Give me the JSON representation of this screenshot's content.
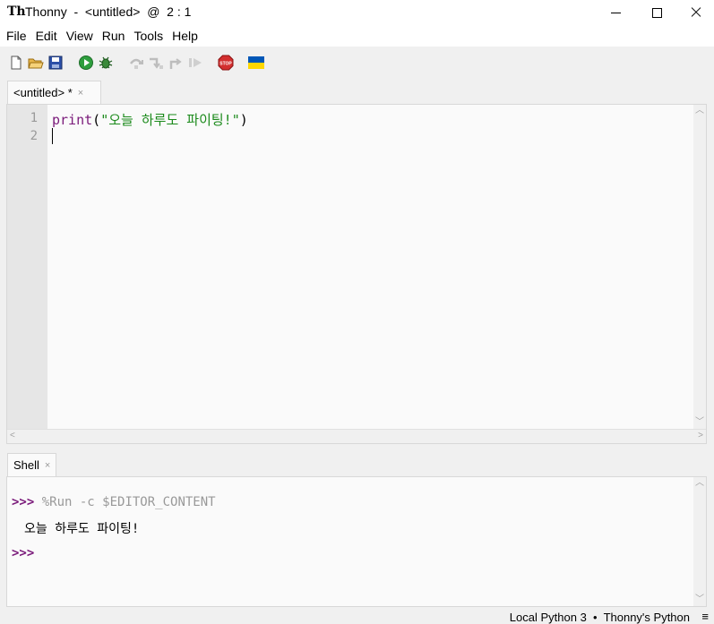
{
  "window": {
    "logo": "Th",
    "title": "Thonny  -  <untitled>  @  2 : 1",
    "controls": {
      "minimize_icon": "minimize-icon",
      "maximize_icon": "maximize-icon",
      "close_icon": "close-icon"
    }
  },
  "menu": [
    "File",
    "Edit",
    "View",
    "Run",
    "Tools",
    "Help"
  ],
  "toolbar": {
    "buttons": [
      {
        "name": "new-file",
        "icon": "new-file-icon"
      },
      {
        "name": "open-file",
        "icon": "folder-open-icon"
      },
      {
        "name": "save-file",
        "icon": "save-icon"
      },
      {
        "name": "run",
        "icon": "run-icon"
      },
      {
        "name": "debug",
        "icon": "bug-icon"
      },
      {
        "name": "step-over",
        "icon": "step-over-icon"
      },
      {
        "name": "step-into",
        "icon": "step-into-icon"
      },
      {
        "name": "step-out",
        "icon": "step-out-icon"
      },
      {
        "name": "resume",
        "icon": "resume-icon"
      },
      {
        "name": "stop",
        "icon": "stop-icon",
        "label": "STOP"
      },
      {
        "name": "ukraine-support",
        "icon": "ukraine-flag-icon"
      }
    ]
  },
  "editor": {
    "tab": {
      "label": "<untitled> *",
      "close": "×"
    },
    "line_numbers": [
      "1",
      "2"
    ],
    "code": {
      "keyword": "print",
      "open": "(",
      "string": "\"오늘 하루도 파이팅!\"",
      "close": ")"
    }
  },
  "shell": {
    "tab": {
      "label": "Shell",
      "close": "×"
    },
    "prompt": ">>>",
    "command": "%Run -c $EDITOR_CONTENT",
    "output": "오늘 하루도 파이팅!"
  },
  "status": {
    "text": "Local Python 3  •  Thonny's Python",
    "menu_glyph": "≡"
  },
  "colors": {
    "keyword": "#7a1a7a",
    "string": "#1b8a1b",
    "prompt": "#7a1a7a",
    "run_green": "#2e9e3e",
    "stop_red": "#d32f2f",
    "flag_blue": "#0057b7",
    "flag_yellow": "#ffd700"
  }
}
